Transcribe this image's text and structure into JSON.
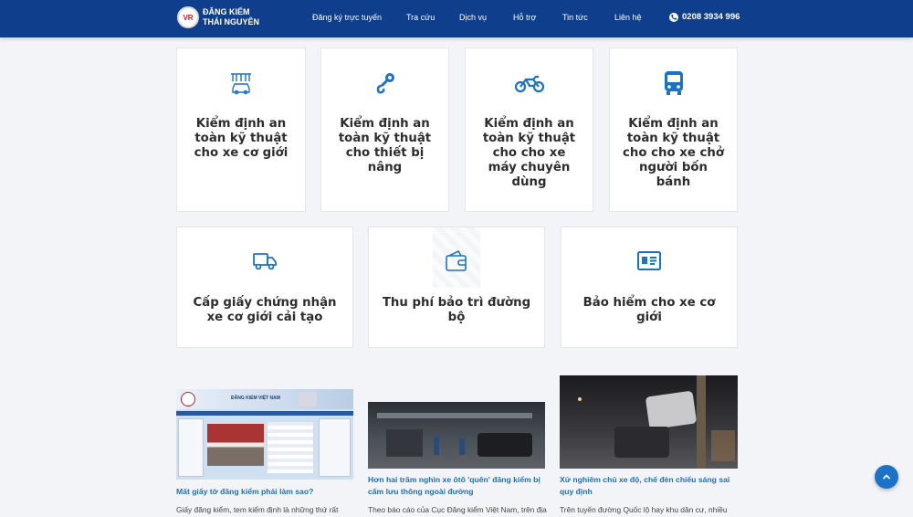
{
  "header": {
    "logo_line1": "ĐĂNG KIỂM",
    "logo_line2": "THÁI NGUYÊN",
    "logo_mark": "VR",
    "nav": [
      "Đăng ký trực tuyến",
      "Tra cứu",
      "Dịch vụ",
      "Hỗ trợ",
      "Tin tức",
      "Liên hệ"
    ],
    "phone": "0208 3934 996"
  },
  "services_row1": [
    {
      "title": "Kiểm định an toàn kỹ thuật cho xe cơ giới",
      "icon": "car-inspection-icon"
    },
    {
      "title": "Kiểm định an toàn kỹ thuật cho thiết bị nâng",
      "icon": "crane-hook-icon"
    },
    {
      "title": "Kiểm định an toàn kỹ thuật cho cho xe máy chuyên dùng",
      "icon": "motorbike-icon"
    },
    {
      "title": "Kiểm định an toàn kỹ thuật cho cho xe chở người bốn bánh",
      "icon": "bus-icon"
    }
  ],
  "services_row2": [
    {
      "title": "Cấp giấy chứng nhận xe cơ giới cải tạo",
      "icon": "truck-icon"
    },
    {
      "title": "Thu phí bảo trì đường bộ",
      "icon": "wallet-icon"
    },
    {
      "title": "Bảo hiểm cho xe cơ giới",
      "icon": "id-card-icon"
    }
  ],
  "news": [
    {
      "title": "Mất giấy tờ đăng kiểm phải làm sao?",
      "desc": "Giấy đăng kiểm, tem kiểm định là những thứ rất",
      "image_caption": "ĐĂNG KIỂM VIỆT NAM"
    },
    {
      "title": "Hơn hai trăm nghìn xe ôtô 'quên' đăng kiểm bị cấm lưu thông ngoài đường",
      "desc": "Theo báo cáo của Cục Đăng kiểm Việt Nam, trên địa"
    },
    {
      "title": "Xử nghiêm chủ xe độ, chế đèn chiếu sáng sai quy định",
      "desc": "Trên tuyến đường Quốc lộ hay khu dân cư, nhiều"
    }
  ],
  "colors": {
    "header": "#0f3f8c",
    "accent": "#1a73c7",
    "title_link": "#1f6fb2"
  }
}
